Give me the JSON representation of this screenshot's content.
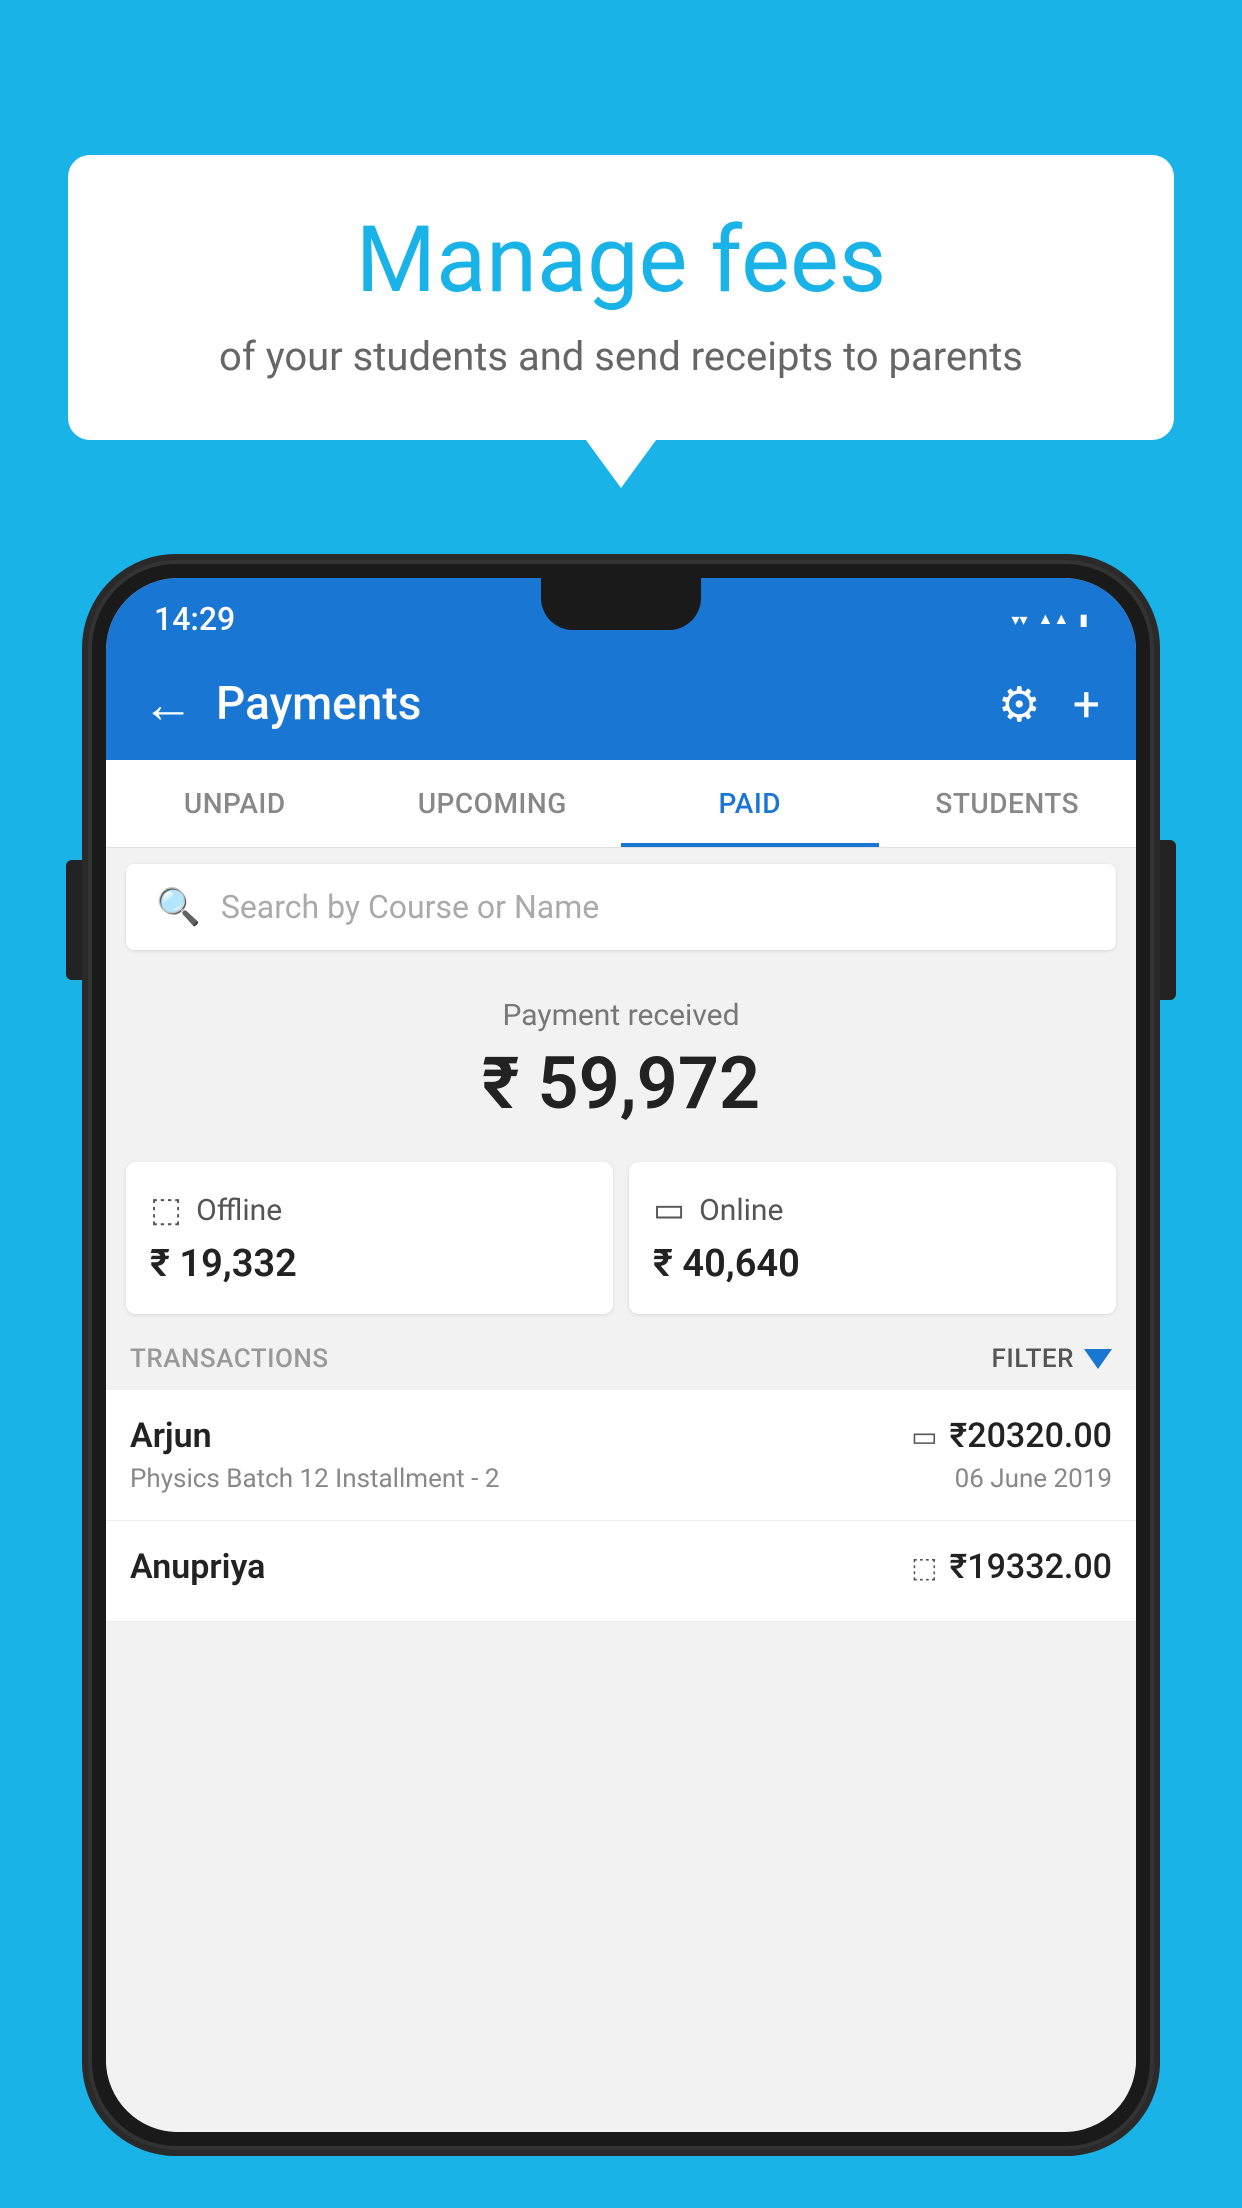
{
  "background_color": "#1ab3e8",
  "speech_bubble": {
    "title": "Manage fees",
    "subtitle": "of your students and send receipts to parents"
  },
  "status_bar": {
    "time": "14:29",
    "wifi": "▼",
    "signal": "▲",
    "battery": "▐"
  },
  "app_bar": {
    "title": "Payments",
    "back_label": "←",
    "gear_label": "⚙",
    "plus_label": "+"
  },
  "tabs": [
    {
      "label": "UNPAID",
      "active": false
    },
    {
      "label": "UPCOMING",
      "active": false
    },
    {
      "label": "PAID",
      "active": true
    },
    {
      "label": "STUDENTS",
      "active": false
    }
  ],
  "search": {
    "placeholder": "Search by Course or Name"
  },
  "payment_section": {
    "label": "Payment received",
    "total": "₹ 59,972",
    "offline_label": "Offline",
    "offline_amount": "₹ 19,332",
    "online_label": "Online",
    "online_amount": "₹ 40,640"
  },
  "transactions_header": {
    "label": "TRANSACTIONS",
    "filter_label": "FILTER"
  },
  "transactions": [
    {
      "name": "Arjun",
      "course": "Physics Batch 12 Installment - 2",
      "amount": "₹20320.00",
      "date": "06 June 2019",
      "payment_type": "online"
    },
    {
      "name": "Anupriya",
      "course": "",
      "amount": "₹19332.00",
      "date": "",
      "payment_type": "offline"
    }
  ]
}
